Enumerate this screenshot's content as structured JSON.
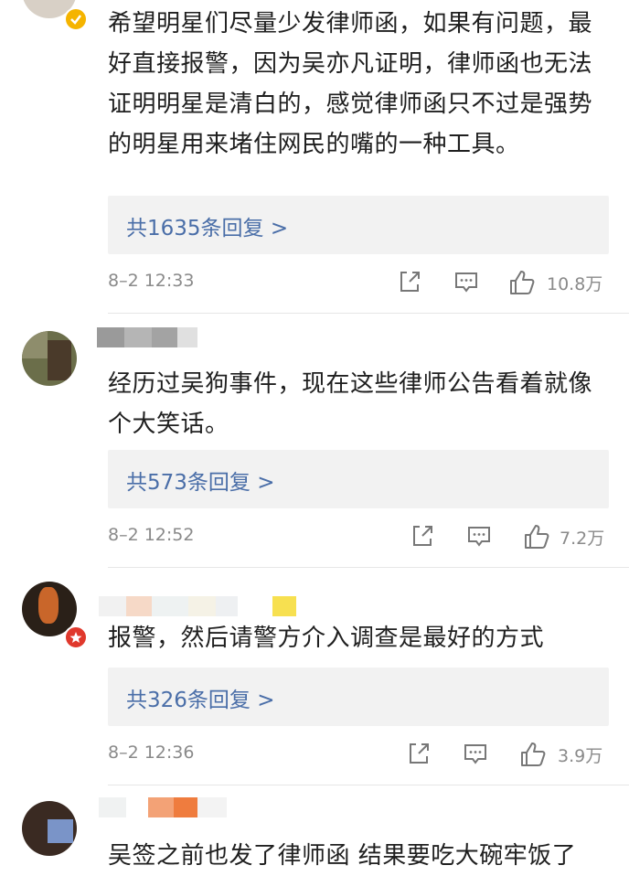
{
  "comments": [
    {
      "text": "希望明星们尽量少发律师函，如果有问题，最好直接报警，因为吴亦凡证明，律师函也无法证明明星是清白的，感觉律师函只不过是强势的明星用来堵住网民的嘴的一种工具。",
      "replies": "共1635条回复 >",
      "time": "8–2 12:33",
      "likes": "10.8万"
    },
    {
      "text": "经历过吴狗事件，现在这些律师公告看着就像个大笑话。",
      "replies": "共573条回复 >",
      "time": "8–2 12:52",
      "likes": "7.2万"
    },
    {
      "text": "报警，然后请警方介入调查是最好的方式",
      "replies": "共326条回复 >",
      "time": "8–2 12:36",
      "likes": "3.9万"
    },
    {
      "text": "吴签之前也发了律师函 结果要吃大碗牢饭了"
    }
  ],
  "icons": [
    "share-icon",
    "comment-icon",
    "like-icon",
    "verified-badge-icon"
  ],
  "colors": {
    "link": "#4a6ea8",
    "meta": "#8a8a8a",
    "reply_bg": "#f2f2f2"
  }
}
